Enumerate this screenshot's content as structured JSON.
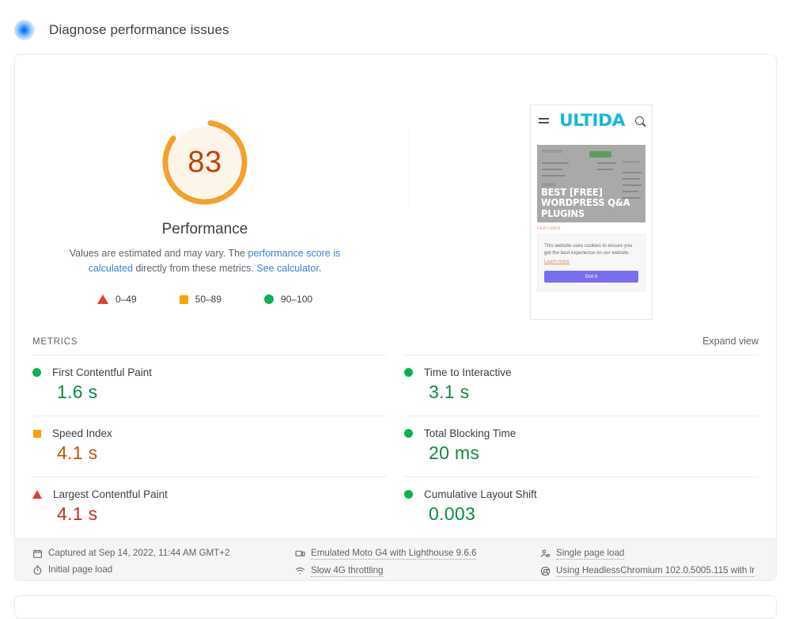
{
  "header": {
    "title": "Diagnose performance issues",
    "icon": "lighthouse-icon"
  },
  "score": {
    "value": "83",
    "value_number": 83,
    "label": "Performance",
    "arc_color": "#f5a02a",
    "fill_color": "#fdf4ea",
    "text_color": "#bf4300",
    "description_part1": "Values are estimated and may vary. The ",
    "description_link1": "performance score is calculated",
    "description_part2": " directly from these metrics. ",
    "description_link2": "See calculator",
    "description_part3": "."
  },
  "legend": [
    {
      "shape": "triangle",
      "range": "0–49",
      "color": "#e63c2f"
    },
    {
      "shape": "square",
      "range": "50–89",
      "color": "#fba100"
    },
    {
      "shape": "circle",
      "range": "90–100",
      "color": "#07b252"
    }
  ],
  "thumbnail": {
    "logo": "ULTIDA",
    "logo_color": "#16b9d8",
    "menu_icon": "hamburger-icon",
    "search_icon": "search-icon",
    "hero_title": "BEST [FREE]\nWORDPRESS Q&A\nPLUGINS",
    "category_label": "FEATURED",
    "cookie_text": "This website uses cookies to ensure you get the best experience on our website.",
    "cookie_link": "Learn more",
    "cookie_button": "Got it",
    "cookie_button_color": "#7a6ef0"
  },
  "metrics_section": {
    "title": "METRICS",
    "expand_label": "Expand view",
    "items": [
      {
        "name": "First Contentful Paint",
        "value": "1.6 s",
        "status": "green"
      },
      {
        "name": "Time to Interactive",
        "value": "3.1 s",
        "status": "green"
      },
      {
        "name": "Speed Index",
        "value": "4.1 s",
        "status": "orange"
      },
      {
        "name": "Total Blocking Time",
        "value": "20 ms",
        "status": "green"
      },
      {
        "name": "Largest Contentful Paint",
        "value": "4.1 s",
        "status": "red"
      },
      {
        "name": "Cumulative Layout Shift",
        "value": "0.003",
        "status": "green"
      }
    ]
  },
  "meta": {
    "captured_at": "Captured at Sep 14, 2022, 11:44 AM GMT+2",
    "page_load": "Initial page load",
    "emulation": "Emulated Moto G4 with Lighthouse 9.6.6",
    "throttling": "Slow 4G throttling",
    "load_type": "Single page load",
    "user_agent": "Using HeadlessChromium 102.0.5005.115 with lr"
  }
}
